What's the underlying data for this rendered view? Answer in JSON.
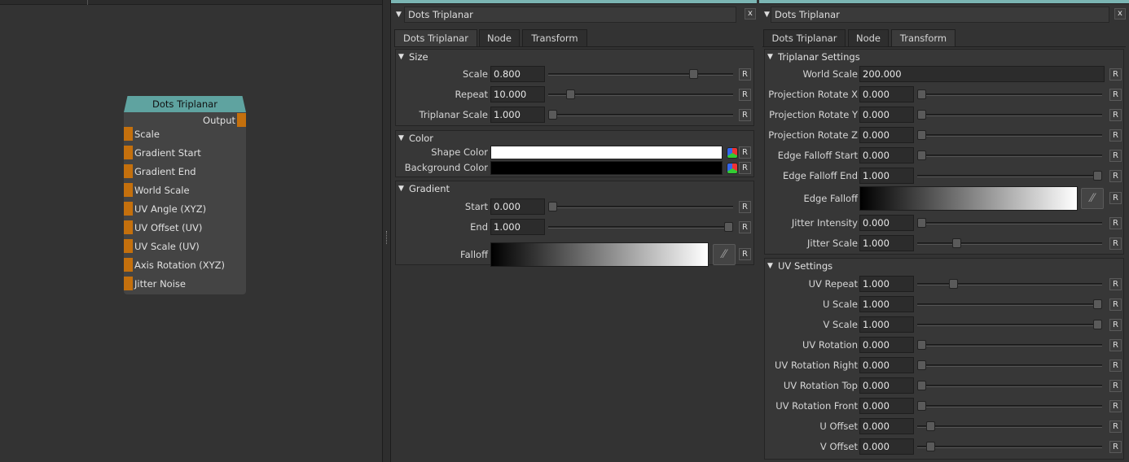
{
  "node": {
    "title": "Dots Triplanar",
    "output_label": "Output",
    "inputs": [
      "Scale",
      "Gradient Start",
      "Gradient End",
      "World Scale",
      "UV Angle (XYZ)",
      "UV Offset (UV)",
      "UV Scale (UV)",
      "Axis Rotation (XYZ)",
      "Jitter Noise"
    ],
    "port_color": "#c4700d",
    "header_color": "#5fa3a0"
  },
  "left_panel": {
    "title": "Dots Triplanar",
    "close": "x",
    "tabs": [
      "Dots Triplanar",
      "Node",
      "Transform"
    ],
    "active_tab": "Dots Triplanar",
    "size_group": {
      "label": "Size",
      "rows": [
        {
          "label": "Scale",
          "value": "0.800",
          "slider": 0.8
        },
        {
          "label": "Repeat",
          "value": "10.000",
          "slider": 0.1
        },
        {
          "label": "Triplanar Scale",
          "value": "1.000",
          "slider": 0.0
        }
      ]
    },
    "color_group": {
      "label": "Color",
      "rows": [
        {
          "label": "Shape Color",
          "color": "#ffffff"
        },
        {
          "label": "Background Color",
          "color": "#000000"
        }
      ]
    },
    "gradient_group": {
      "label": "Gradient",
      "rows": [
        {
          "label": "Start",
          "value": "0.000",
          "slider": 0.0
        },
        {
          "label": "End",
          "value": "1.000",
          "slider": 1.0
        }
      ],
      "falloff_label": "Falloff"
    },
    "reset": "R"
  },
  "right_panel": {
    "title": "Dots Triplanar",
    "close": "x",
    "tabs": [
      "Dots Triplanar",
      "Node",
      "Transform"
    ],
    "active_tab": "Transform",
    "triplanar_group": {
      "label": "Triplanar Settings",
      "world_scale": {
        "label": "World Scale",
        "value": "200.000"
      },
      "rows": [
        {
          "label": "Projection Rotate X",
          "value": "0.000",
          "slider": 0.0
        },
        {
          "label": "Projection Rotate Y",
          "value": "0.000",
          "slider": 0.0
        },
        {
          "label": "Projection Rotate Z",
          "value": "0.000",
          "slider": 0.0
        },
        {
          "label": "Edge Falloff Start",
          "value": "0.000",
          "slider": 0.0
        },
        {
          "label": "Edge Falloff End",
          "value": "1.000",
          "slider": 1.0
        }
      ],
      "edge_falloff_label": "Edge Falloff",
      "rows2": [
        {
          "label": "Jitter Intensity",
          "value": "0.000",
          "slider": 0.0
        },
        {
          "label": "Jitter Scale",
          "value": "1.000",
          "slider": 0.2
        }
      ]
    },
    "uv_group": {
      "label": "UV Settings",
      "rows": [
        {
          "label": "UV Repeat",
          "value": "1.000",
          "slider": 0.18
        },
        {
          "label": "U Scale",
          "value": "1.000",
          "slider": 1.0
        },
        {
          "label": "V Scale",
          "value": "1.000",
          "slider": 1.0
        },
        {
          "label": "UV Rotation",
          "value": "0.000",
          "slider": 0.0
        },
        {
          "label": "UV Rotation Right",
          "value": "0.000",
          "slider": 0.0
        },
        {
          "label": "UV Rotation Top",
          "value": "0.000",
          "slider": 0.0
        },
        {
          "label": "UV Rotation Front",
          "value": "0.000",
          "slider": 0.0
        },
        {
          "label": "U Offset",
          "value": "0.000",
          "slider": 0.05
        },
        {
          "label": "V Offset",
          "value": "0.000",
          "slider": 0.05
        }
      ]
    },
    "reset": "R"
  }
}
